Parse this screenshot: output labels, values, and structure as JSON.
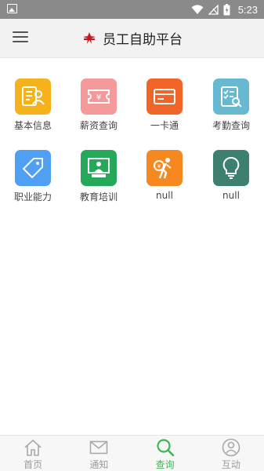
{
  "status_bar": {
    "time": "5:23"
  },
  "header": {
    "title": "员工自助平台"
  },
  "grid": {
    "items": [
      {
        "label": "基本信息",
        "icon": "id-card-icon",
        "color": "#f6b21b"
      },
      {
        "label": "薪资查询",
        "icon": "salary-ticket-icon",
        "color": "#f59a9a"
      },
      {
        "label": "一卡通",
        "icon": "card-icon",
        "color": "#f26529"
      },
      {
        "label": "考勤查询",
        "icon": "attendance-checklist-icon",
        "color": "#67b8d1"
      },
      {
        "label": "职业能力",
        "icon": "tag-icon",
        "color": "#4f9ff2"
      },
      {
        "label": "教育培训",
        "icon": "training-board-icon",
        "color": "#25a85a"
      },
      {
        "label": "null",
        "icon": "porter-icon",
        "color": "#f5881f"
      },
      {
        "label": "null",
        "icon": "lightbulb-icon",
        "color": "#3e8070"
      }
    ]
  },
  "tabbar": {
    "tabs": [
      {
        "label": "首页",
        "icon": "home-icon"
      },
      {
        "label": "通知",
        "icon": "envelope-icon"
      },
      {
        "label": "查询",
        "icon": "search-icon",
        "active": true
      },
      {
        "label": "互动",
        "icon": "chat-user-icon"
      }
    ],
    "active_color": "#3db655",
    "inactive_color": "#9c9c9c"
  }
}
